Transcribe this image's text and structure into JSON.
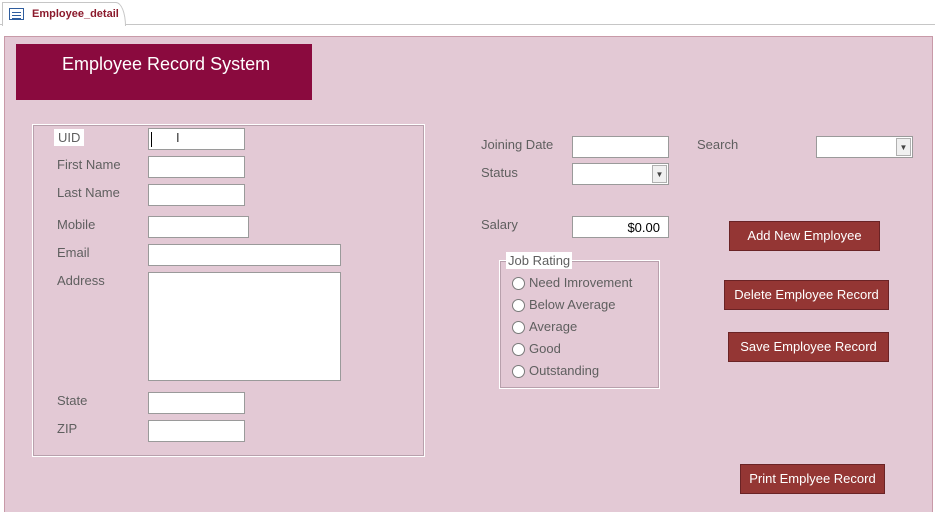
{
  "tab": {
    "title": "Employee_detail",
    "icon": "form-icon"
  },
  "banner": {
    "title": "Employee Record System"
  },
  "fields": {
    "uid": {
      "label": "UID",
      "value": ""
    },
    "first_name": {
      "label": "First Name",
      "value": ""
    },
    "last_name": {
      "label": "Last Name",
      "value": ""
    },
    "mobile": {
      "label": "Mobile",
      "value": ""
    },
    "email": {
      "label": "Email",
      "value": ""
    },
    "address": {
      "label": "Address",
      "value": ""
    },
    "state": {
      "label": "State",
      "value": ""
    },
    "zip": {
      "label": "ZIP",
      "value": ""
    },
    "joining_date": {
      "label": "Joining Date",
      "value": ""
    },
    "status": {
      "label": "Status",
      "value": ""
    },
    "search": {
      "label": "Search",
      "value": ""
    },
    "salary": {
      "label": "Salary",
      "value": "$0.00"
    }
  },
  "job_rating": {
    "title": "Job Rating",
    "options": [
      "Need Imrovement",
      "Below Average",
      "Average",
      "Good",
      "Outstanding"
    ]
  },
  "buttons": {
    "add": "Add New Employee",
    "delete": "Delete Employee Record",
    "save": "Save Employee  Record",
    "print": "Print Emplyee Record"
  },
  "colors": {
    "form_background": "#e3c9d5",
    "banner": "#8a0a3e",
    "button": "#943634"
  }
}
